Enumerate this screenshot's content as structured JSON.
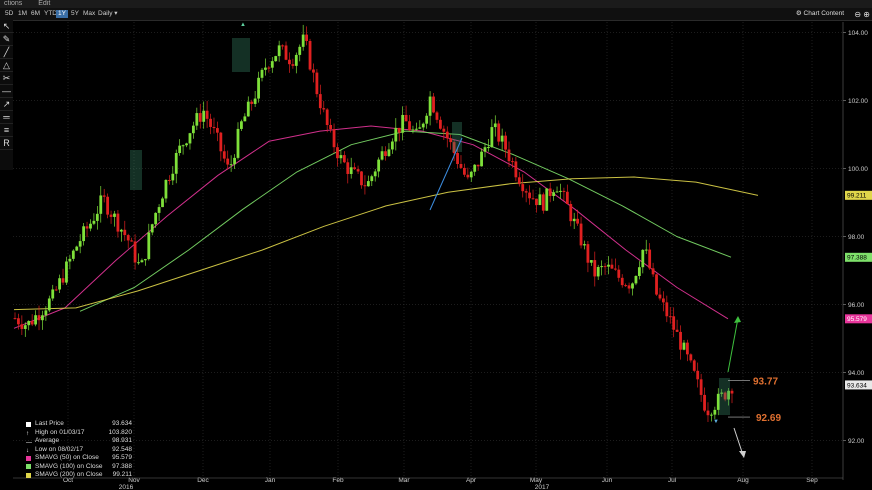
{
  "menu": {
    "items": [
      "ctions",
      "Edit"
    ]
  },
  "toolbar": {
    "ranges": [
      "5D",
      "1M",
      "6M",
      "YTD",
      "1Y",
      "5Y",
      "Max"
    ],
    "active_range": "1Y",
    "frequency": "Daily",
    "chart_button": "Chart Content",
    "zoom_buttons": "⊖ ⊕"
  },
  "tools": [
    "pointer-icon",
    "pencil-icon",
    "trend-icon",
    "shapes-icon",
    "annotate-icon",
    "line-icon",
    "ray-icon",
    "channel-icon",
    "fib-icon",
    "research-icon"
  ],
  "tool_glyphs": [
    "↖",
    "✎",
    "╱",
    "△",
    "✂",
    "—",
    "↗",
    "═",
    "≡",
    "R"
  ],
  "legend": {
    "rows": [
      {
        "label": "Last Price",
        "value": "93.634",
        "color": "#ffffff",
        "marker": "square"
      },
      {
        "label": "High on 01/03/17",
        "value": "103.820",
        "color": "#ffffff",
        "marker": "up"
      },
      {
        "label": "Average",
        "value": "98.931",
        "color": "#ffffff",
        "marker": "dash"
      },
      {
        "label": "Low on 08/02/17",
        "value": "92.548",
        "color": "#ffffff",
        "marker": "down"
      },
      {
        "label": "SMAVG (50) on Close",
        "value": "95.579",
        "color": "#e8359b",
        "marker": "square"
      },
      {
        "label": "SMAVG (100) on Close",
        "value": "97.388",
        "color": "#7ee06a",
        "marker": "square"
      },
      {
        "label": "SMAVG (200) on Close",
        "value": "99.211",
        "color": "#e0d64a",
        "marker": "square"
      }
    ]
  },
  "annotations": {
    "up_target": "93.77",
    "down_target": "92.69",
    "color": "#e07030"
  },
  "chart_data": {
    "type": "line",
    "price_type": "candlestick",
    "title": "",
    "xlabel": "",
    "ylabel": "",
    "ylim": [
      90.6,
      104.4
    ],
    "y_ticks": [
      "104.00",
      "102.00",
      "100.00",
      "98.00",
      "96.00",
      "94.00",
      "92.00"
    ],
    "x_ticks": [
      "Oct",
      "Nov",
      "Dec",
      "Jan",
      "Feb",
      "Mar",
      "Apr",
      "May",
      "Jun",
      "Jul",
      "Aug",
      "Sep"
    ],
    "x_year_labels": [
      "2016",
      "2017"
    ],
    "last_price": 93.634,
    "high": {
      "date": "01/03/17",
      "value": 103.82
    },
    "average": 98.931,
    "low": {
      "date": "08/02/17",
      "value": 92.548
    },
    "price_path": [
      95.6,
      95.4,
      95.8,
      96.2,
      97.0,
      97.8,
      98.4,
      99.1,
      98.5,
      97.9,
      97.0,
      98.5,
      99.6,
      100.5,
      101.2,
      101.7,
      100.9,
      99.9,
      101.3,
      102.1,
      103.1,
      103.5,
      103.2,
      103.8,
      102.3,
      101.0,
      100.2,
      99.8,
      99.5,
      100.3,
      101.0,
      101.4,
      100.9,
      102.1,
      101.2,
      100.4,
      99.6,
      100.3,
      101.2,
      100.6,
      99.8,
      99.2,
      99.0,
      99.6,
      98.8,
      97.9,
      96.9,
      97.1,
      96.8,
      96.6,
      97.7,
      96.3,
      95.6,
      94.8,
      93.9,
      92.9,
      93.2,
      93.63
    ],
    "series": [
      {
        "name": "SMAVG (50) on Close",
        "color": "#e8359b",
        "last": 95.579,
        "values": [
          95.3,
          95.9,
          97.3,
          98.6,
          99.8,
          100.8,
          101.1,
          101.25,
          101.1,
          100.7,
          99.9,
          98.8,
          97.6,
          96.5,
          95.58
        ]
      },
      {
        "name": "SMAVG (100) on Close",
        "color": "#7ee06a",
        "last": 97.388,
        "values": [
          95.8,
          96.5,
          97.6,
          98.8,
          99.9,
          100.7,
          101.1,
          101.0,
          100.4,
          99.7,
          98.9,
          98.0,
          97.39
        ]
      },
      {
        "name": "SMAVG (200) on Close",
        "color": "#e0d64a",
        "last": 99.211,
        "values": [
          95.85,
          95.9,
          96.4,
          97.0,
          97.6,
          98.3,
          98.9,
          99.3,
          99.55,
          99.7,
          99.75,
          99.6,
          99.21
        ]
      }
    ],
    "grid": true,
    "legend_position": "bottom-left"
  }
}
